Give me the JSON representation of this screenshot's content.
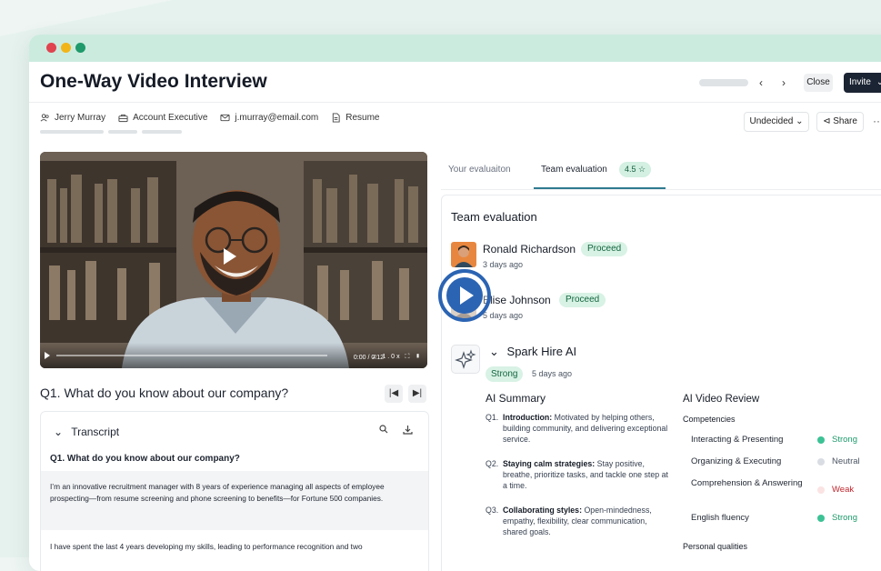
{
  "colors": {
    "accent_teal": "#2f7a90",
    "strong_green": "#3cc295",
    "neutral_gray": "#d9dde3",
    "weak_pink": "#fbe3e3",
    "weak_text": "#c0262d",
    "play_blue": "#2b64b3",
    "invite_dark": "#1b2433"
  },
  "header": {
    "title": "One-Way Video Interview",
    "prev_icon": "chevron-left-icon",
    "next_icon": "chevron-right-icon",
    "close_label": "Close",
    "invite_label": "Invite"
  },
  "candidate": {
    "name": "Jerry Murray",
    "role": "Account Executive",
    "email": "j.murray@email.com",
    "resume_label": "Resume",
    "status_label": "Undecided",
    "share_label": "Share",
    "more_label": "···"
  },
  "video": {
    "time": "0:00 / 0:12",
    "speed": "1.0x",
    "played_fraction": 0.0
  },
  "question": {
    "title": "Q1. What do you know about our company?"
  },
  "transcript": {
    "header": "Transcript",
    "question": "Q1. What do you know about our company?",
    "paragraph1": "I’m an innovative recruitment manager with 8 years of experience managing all aspects of employee prospecting—from resume screening and phone screening to benefits—for Fortune 500 companies.",
    "paragraph2": "I have spent the last 4 years developing my skills, leading to performance recognition and two"
  },
  "tabs": {
    "your_eval": "Your evaluaiton",
    "team_eval": "Team evaluation",
    "team_score": "4.5"
  },
  "team_evaluation": {
    "title": "Team evaluation",
    "evaluators": [
      {
        "name": "Ronald Richardson",
        "decision": "Proceed",
        "time": "3 days ago"
      },
      {
        "name": "Elise Johnson",
        "decision": "Proceed",
        "time": "5 days ago"
      }
    ]
  },
  "spark": {
    "title": "Spark Hire AI",
    "rating": "Strong",
    "time": "5 days ago",
    "summary_title": "AI Summary",
    "summary": [
      {
        "num": "Q1.",
        "bold": "Introduction:",
        "text": " Motivated by helping others, building community, and delivering  exceptional service."
      },
      {
        "num": "Q2.",
        "bold": "Staying calm strategies:",
        "text": " Stay positive, breathe, prioritize tasks, and tackle one step at a time."
      },
      {
        "num": "Q3.",
        "bold": "Collaborating styles:",
        "text": " Open-mindedness, empathy, flexibility, clear communication, shared goals."
      }
    ],
    "review_title": "AI Video Review",
    "competencies_label": "Competencies",
    "competencies": [
      {
        "name": "Interacting & Presenting",
        "rating": "Strong"
      },
      {
        "name": "Organizing & Executing",
        "rating": "Neutral"
      },
      {
        "name": "Comprehension & Answering",
        "rating": "Weak"
      },
      {
        "name": "English fluency",
        "rating": "Strong"
      }
    ],
    "personal_label": "Personal qualities"
  }
}
